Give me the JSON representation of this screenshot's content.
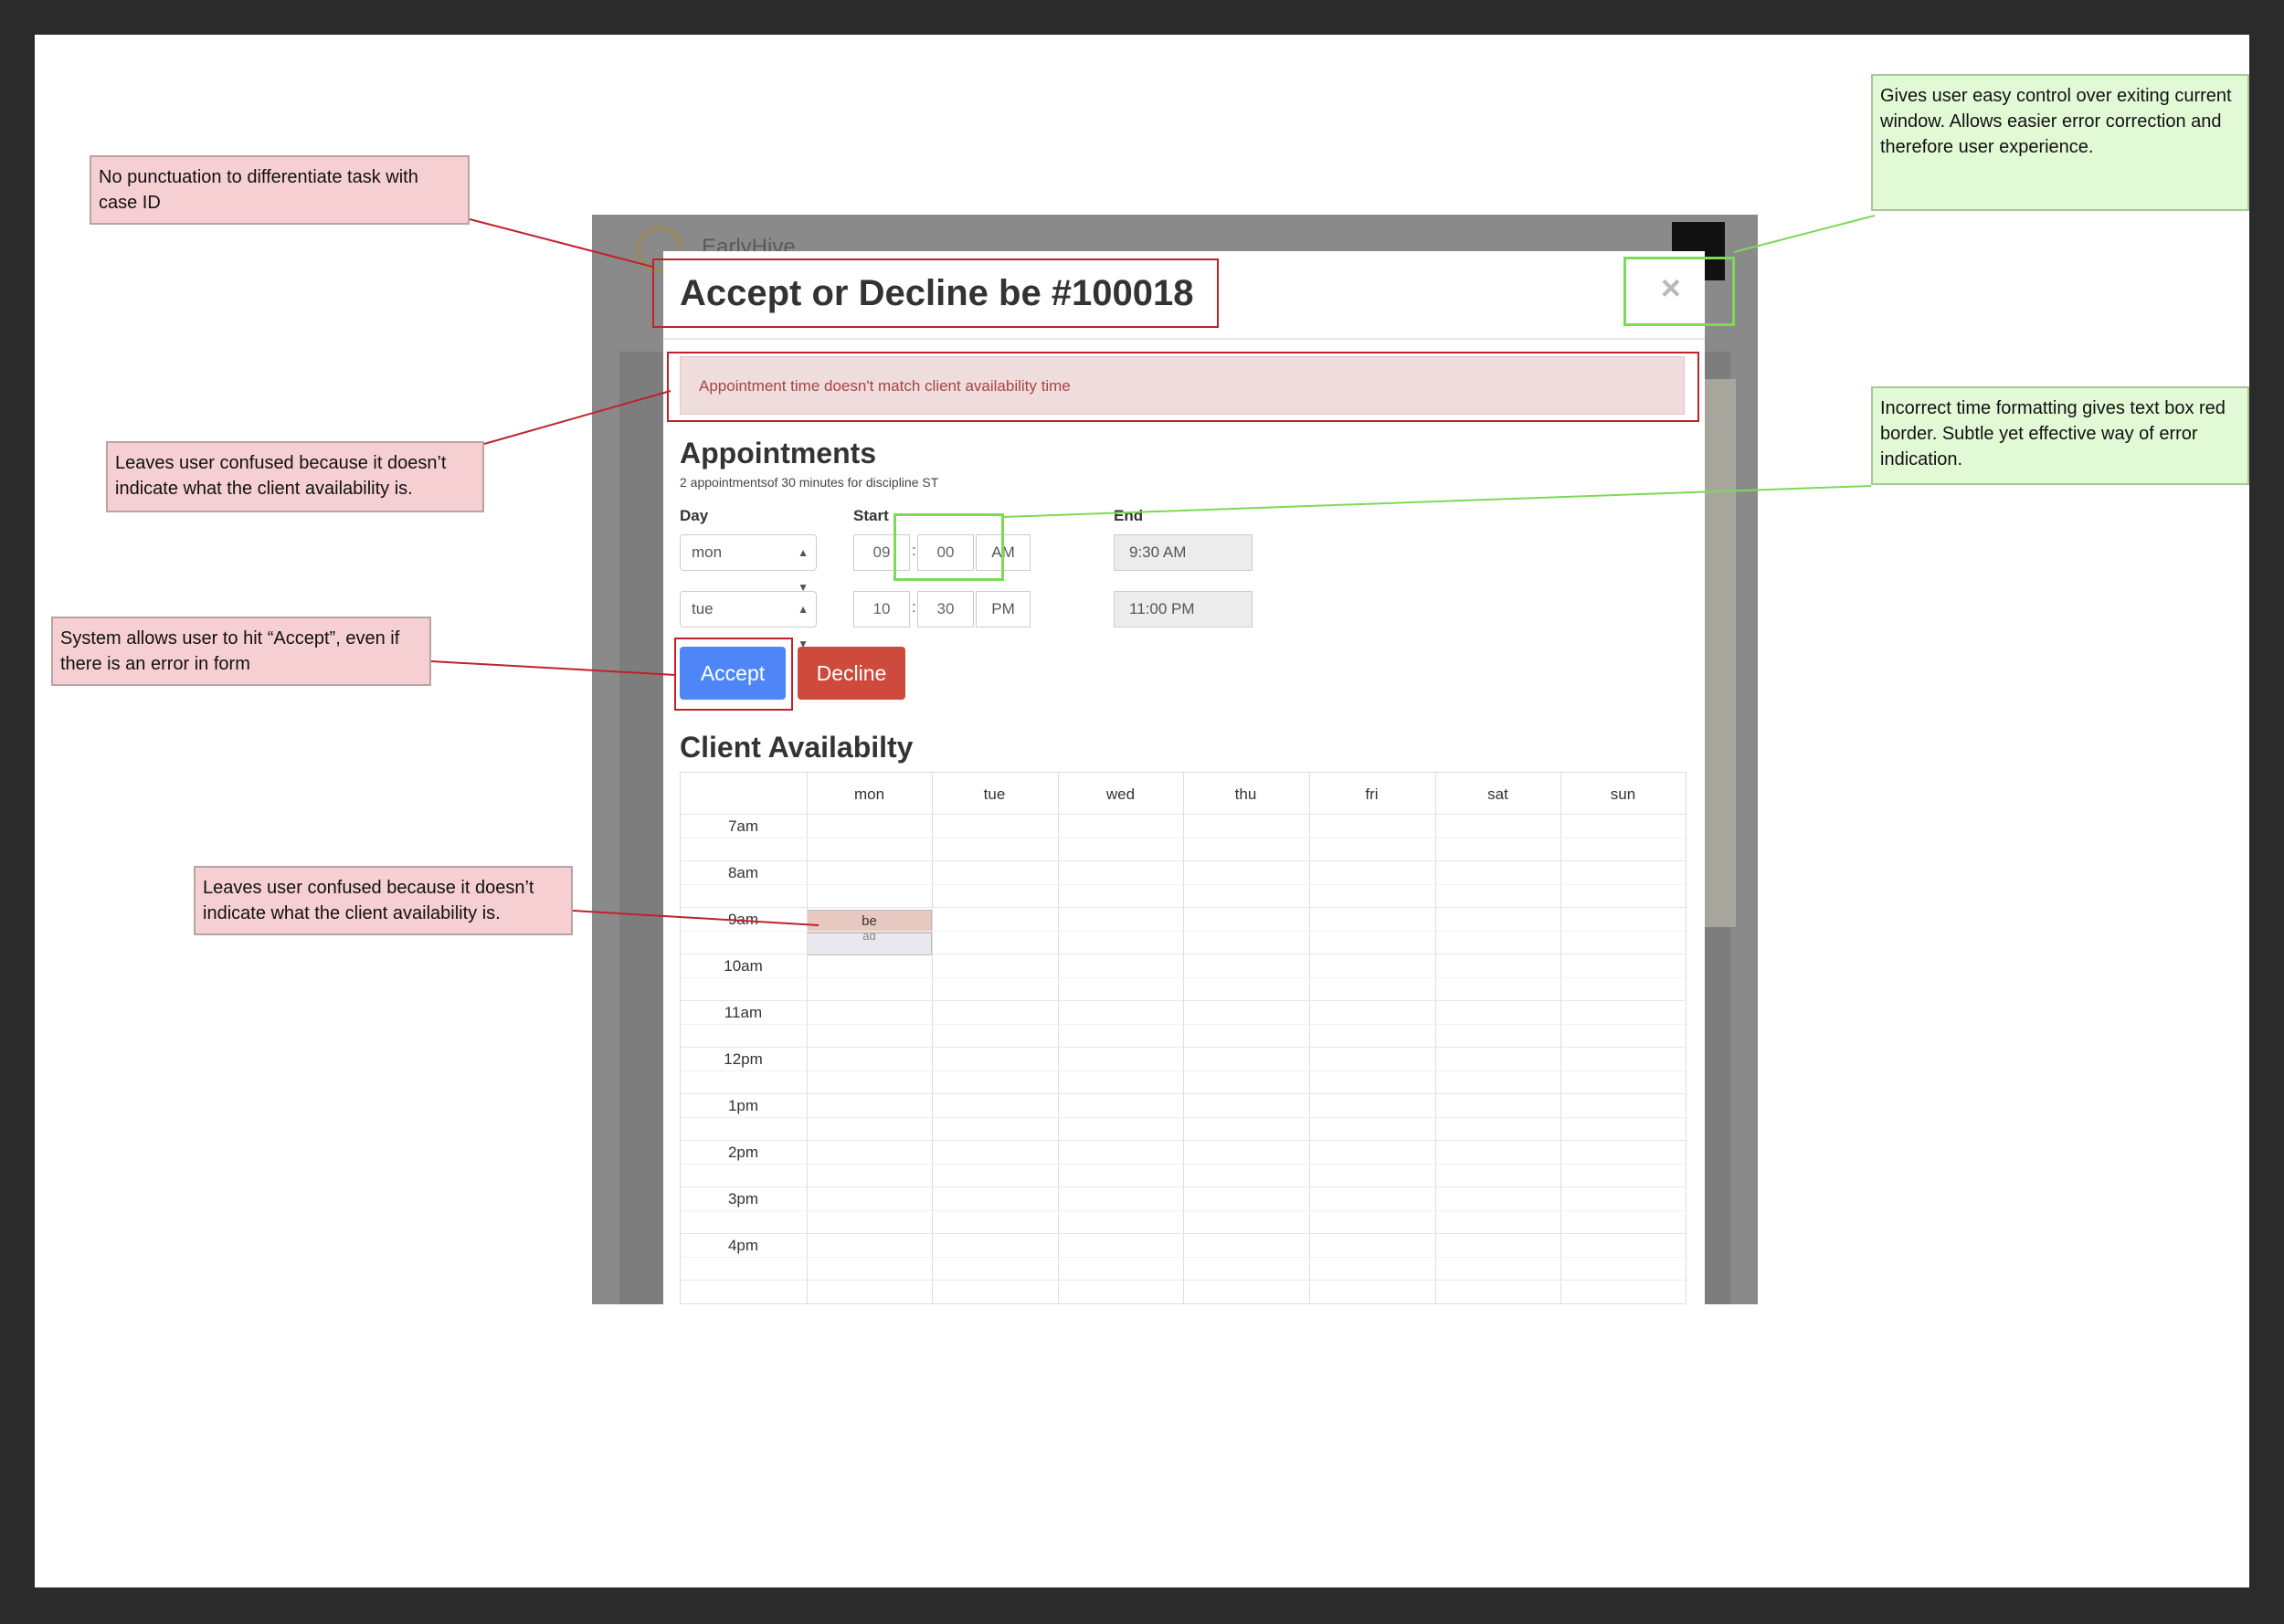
{
  "app": {
    "name": "EarlyHive"
  },
  "modal": {
    "title": "Accept or Decline be #100018",
    "close_glyph": "×",
    "alert": "Appointment time doesn't match client availability time",
    "appointments": {
      "heading": "Appointments",
      "subtitle": "2 appointmentsof 30 minutes for discipline ST",
      "labels": {
        "day": "Day",
        "start": "Start",
        "end": "End"
      },
      "rows": [
        {
          "day": "mon",
          "hour": "09",
          "minute": "00",
          "ampm": "AM",
          "end": "9:30 AM"
        },
        {
          "day": "tue",
          "hour": "10",
          "minute": "30",
          "ampm": "PM",
          "end": "11:00 PM"
        }
      ]
    },
    "buttons": {
      "accept": "Accept",
      "decline": "Decline"
    },
    "availability": {
      "heading": "Client Availabilty",
      "days": [
        "mon",
        "tue",
        "wed",
        "thu",
        "fri",
        "sat",
        "sun"
      ],
      "times": [
        "7am",
        "8am",
        "9am",
        "10am",
        "11am",
        "12pm",
        "1pm",
        "2pm",
        "3pm",
        "4pm"
      ],
      "event": {
        "label": "be",
        "day": "mon",
        "time": "9am"
      }
    }
  },
  "annotations": [
    {
      "text": "No punctuation to differentiate task with case ID",
      "color": "red"
    },
    {
      "text": "Leaves user confused because it doesn’t indicate what the client availability is.",
      "color": "red"
    },
    {
      "text": "System allows user to hit “Accept”, even if there is an error in form",
      "color": "red"
    },
    {
      "text": "Leaves user confused because it doesn’t indicate what the client availability is.",
      "color": "red"
    },
    {
      "text": "Gives user easy control over exiting current window. Allows easier error correction and therefore user experience.",
      "color": "green"
    },
    {
      "text": "Incorrect time formatting gives text box red border. Subtle yet effective way of error indication.",
      "color": "green"
    }
  ],
  "colors": {
    "accept": "#4f86f7",
    "decline": "#cd4a3c",
    "alert_bg": "#efdcdd",
    "alert_text": "#a94442",
    "note_red": "#f6cfd2",
    "note_green": "#e2f9d6",
    "annotation_red": "#c0222c",
    "annotation_green": "#7ed957"
  }
}
